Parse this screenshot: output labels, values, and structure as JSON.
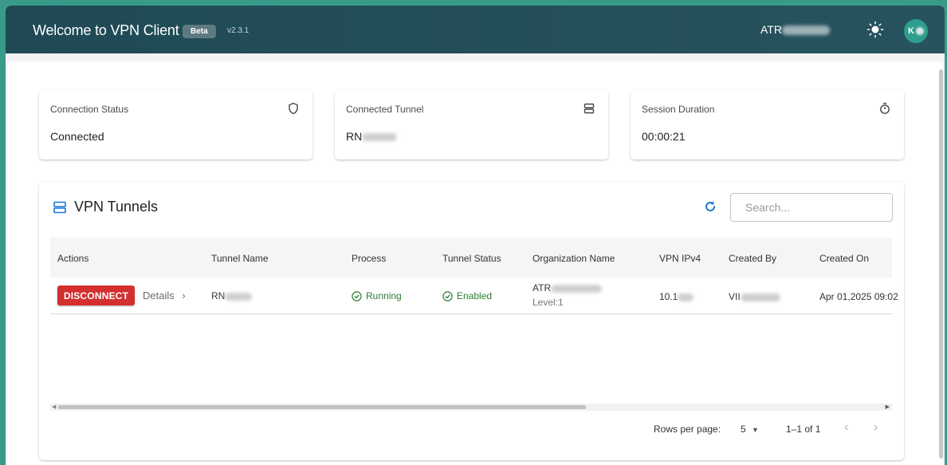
{
  "header": {
    "title": "Welcome to VPN Client",
    "badge": "Beta",
    "version": "v2.3.1",
    "user_prefix": "ATR",
    "avatar_letter": "K",
    "icons": [
      "sun-icon"
    ]
  },
  "stats": [
    {
      "label": "Connection Status",
      "value": "Connected",
      "icon": "shield-icon"
    },
    {
      "label": "Connected Tunnel",
      "value": "RN",
      "icon": "server-icon"
    },
    {
      "label": "Session Duration",
      "value": "00:00:21",
      "icon": "stopwatch-icon"
    }
  ],
  "tunnels": {
    "title": "VPN Tunnels",
    "search_placeholder": "Search...",
    "columns": [
      "Actions",
      "Tunnel Name",
      "Process",
      "Tunnel Status",
      "Organization Name",
      "VPN IPv4",
      "Created By",
      "Created On"
    ],
    "rows": [
      {
        "action_label": "DISCONNECT",
        "details_label": "Details",
        "tunnel_name": "RN",
        "process": "Running",
        "status": "Enabled",
        "org_name": "ATR",
        "org_level": "Level:1",
        "vpn_ipv4": "10.1",
        "created_by": "VII",
        "created_on": "Apr 01,2025 09:02"
      }
    ]
  },
  "pagination": {
    "rows_per_page_label": "Rows per page:",
    "rows_per_page_value": "5",
    "range_label": "1–1 of 1"
  },
  "colors": {
    "header_bg": "#1f4a55",
    "accent": "#1976d2",
    "danger": "#d32f2f",
    "success": "#2e7d32"
  }
}
